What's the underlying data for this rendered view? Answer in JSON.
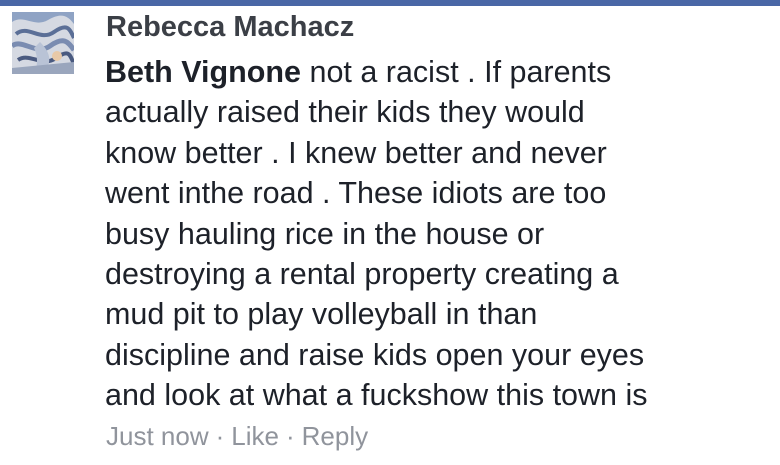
{
  "comment": {
    "author": "Rebecca Machacz",
    "mention": "Beth Vignone",
    "lines": [
      " not a racist . If parents",
      "actually raised their kids they would",
      "know better . I knew better and never",
      "went inthe road . These idiots are too",
      "busy hauling rice in the house or",
      "destroying a rental property creating a",
      "mud pit to play volleyball in than",
      "discipline and raise kids open your eyes",
      "and look at what a fuckshow this town is"
    ],
    "timestamp": "Just now",
    "separator": "·",
    "like_label": "Like",
    "reply_label": "Reply"
  },
  "colors": {
    "top_bar": "#4a67a6",
    "author": "#3b3f46",
    "text": "#1d2129",
    "meta": "#90949c"
  },
  "icons": {
    "avatar": "avatar-photo"
  }
}
